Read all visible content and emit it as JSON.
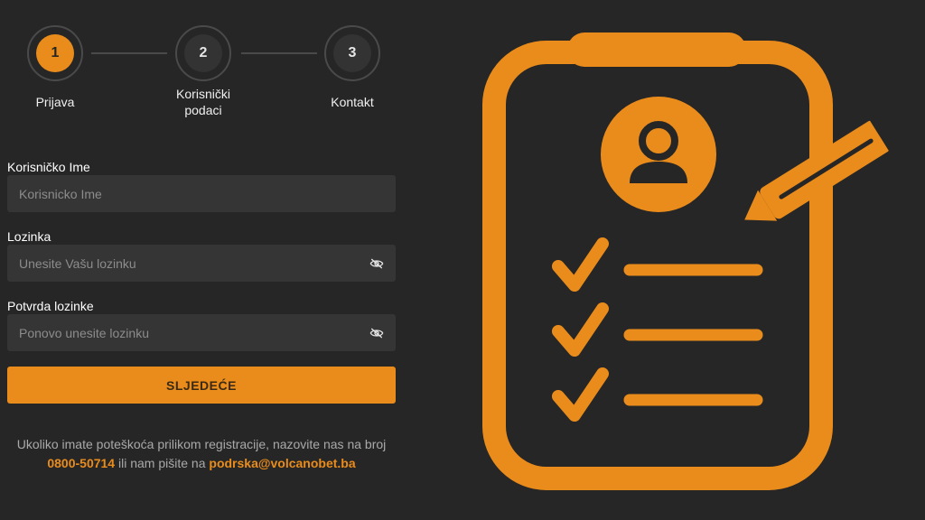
{
  "stepper": {
    "steps": [
      {
        "number": "1",
        "label": "Prijava",
        "active": true
      },
      {
        "number": "2",
        "label_line1": "Korisnički",
        "label_line2": "podaci",
        "active": false
      },
      {
        "number": "3",
        "label": "Kontakt",
        "active": false
      }
    ]
  },
  "form": {
    "username": {
      "label": "Korisničko Ime",
      "placeholder": "Korisnicko Ime",
      "value": ""
    },
    "password": {
      "label": "Lozinka",
      "placeholder": "Unesite Vašu lozinku",
      "value": ""
    },
    "confirm_password": {
      "label": "Potvrda lozinke",
      "placeholder": "Ponovo unesite lozinku",
      "value": ""
    },
    "submit_label": "SLJEDEĆE"
  },
  "help": {
    "text1": "Ukoliko imate poteškoća prilikom registracije, nazovite nas na broj",
    "phone": "0800-50714",
    "text2": "ili nam pišite na",
    "email": "podrska@volcanobet.ba"
  },
  "icons": {
    "password_toggle": "eye-off-icon",
    "confirm_toggle": "eye-off-icon",
    "illustration": "clipboard-profile-checklist-icon"
  },
  "colors": {
    "accent": "#ea8c1b",
    "background": "#262626",
    "input_bg": "#353535"
  }
}
